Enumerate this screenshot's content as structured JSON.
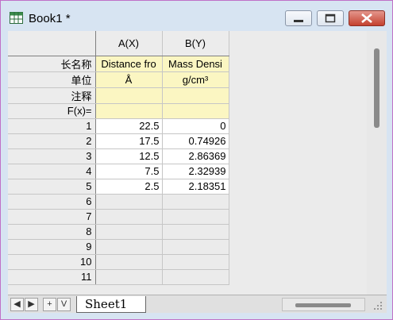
{
  "window": {
    "title": "Book1 *"
  },
  "columns": [
    {
      "header": "A(X)"
    },
    {
      "header": "B(Y)"
    }
  ],
  "meta_rows": [
    {
      "label": "长名称",
      "a": "Distance fro",
      "b": "Mass Densi"
    },
    {
      "label": "单位",
      "a": "Å",
      "b": "g/cm³"
    },
    {
      "label": "注释",
      "a": "",
      "b": ""
    },
    {
      "label": "F(x)=",
      "a": "",
      "b": ""
    }
  ],
  "data_rows": [
    {
      "index": "1",
      "a": "22.5",
      "b": "0"
    },
    {
      "index": "2",
      "a": "17.5",
      "b": "0.74926"
    },
    {
      "index": "3",
      "a": "12.5",
      "b": "2.86369"
    },
    {
      "index": "4",
      "a": "7.5",
      "b": "2.32939"
    },
    {
      "index": "5",
      "a": "2.5",
      "b": "2.18351"
    }
  ],
  "empty_rows": [
    "6",
    "7",
    "8",
    "9",
    "10",
    "11"
  ],
  "nav": {
    "first": "◀",
    "last": "▶",
    "add": "+",
    "menu": "V"
  },
  "sheet_tab": "Sheet1"
}
